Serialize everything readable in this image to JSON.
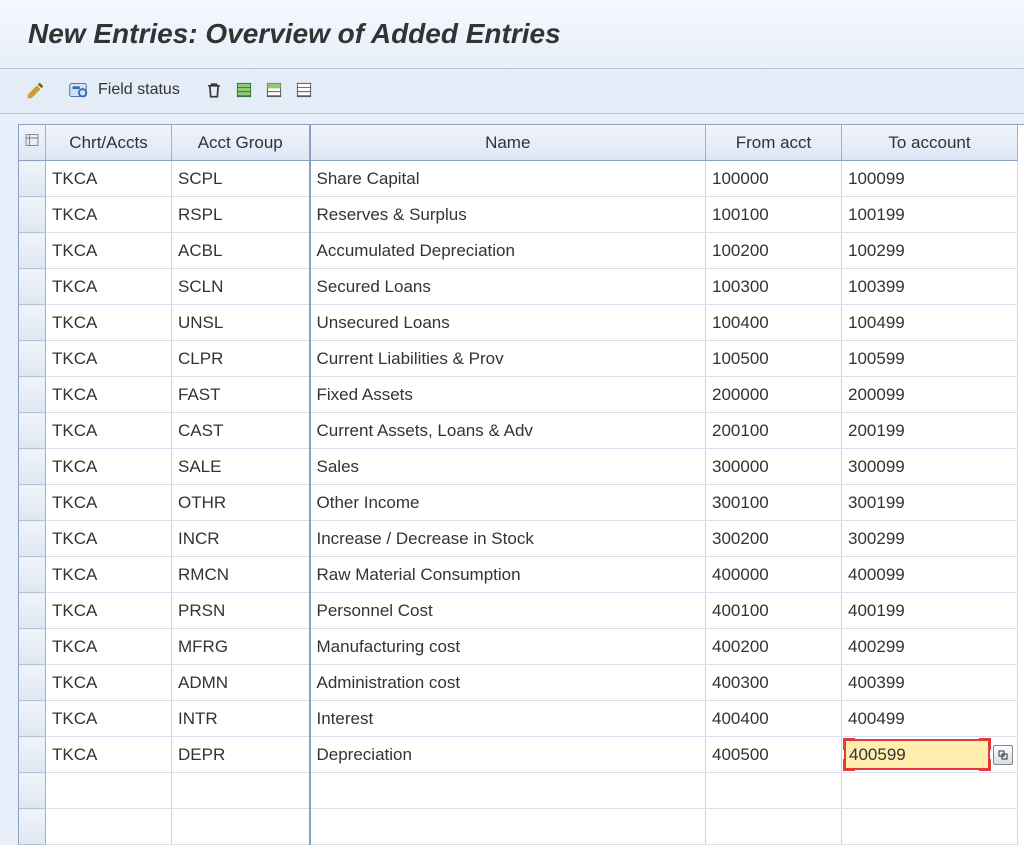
{
  "title": "New Entries: Overview of Added Entries",
  "toolbar": {
    "field_status_label": "Field status"
  },
  "table": {
    "headers": {
      "chrt": "Chrt/Accts",
      "grp": "Acct Group",
      "name": "Name",
      "from": "From acct",
      "to": "To account"
    },
    "rows": [
      {
        "chrt": "TKCA",
        "grp": "SCPL",
        "name": "Share Capital",
        "from": "100000",
        "to": "100099"
      },
      {
        "chrt": "TKCA",
        "grp": "RSPL",
        "name": "Reserves & Surplus",
        "from": "100100",
        "to": "100199"
      },
      {
        "chrt": "TKCA",
        "grp": "ACBL",
        "name": "Accumulated Depreciation",
        "from": "100200",
        "to": "100299"
      },
      {
        "chrt": "TKCA",
        "grp": "SCLN",
        "name": "Secured Loans",
        "from": "100300",
        "to": "100399"
      },
      {
        "chrt": "TKCA",
        "grp": "UNSL",
        "name": "Unsecured Loans",
        "from": "100400",
        "to": "100499"
      },
      {
        "chrt": "TKCA",
        "grp": "CLPR",
        "name": "Current Liabilities & Prov",
        "from": "100500",
        "to": "100599"
      },
      {
        "chrt": "TKCA",
        "grp": "FAST",
        "name": "Fixed Assets",
        "from": "200000",
        "to": "200099"
      },
      {
        "chrt": "TKCA",
        "grp": "CAST",
        "name": "Current Assets, Loans & Adv",
        "from": "200100",
        "to": "200199"
      },
      {
        "chrt": "TKCA",
        "grp": "SALE",
        "name": "Sales",
        "from": "300000",
        "to": "300099"
      },
      {
        "chrt": "TKCA",
        "grp": "OTHR",
        "name": "Other Income",
        "from": "300100",
        "to": "300199"
      },
      {
        "chrt": "TKCA",
        "grp": "INCR",
        "name": "Increase / Decrease in Stock",
        "from": "300200",
        "to": "300299"
      },
      {
        "chrt": "TKCA",
        "grp": "RMCN",
        "name": "Raw Material Consumption",
        "from": "400000",
        "to": "400099"
      },
      {
        "chrt": "TKCA",
        "grp": "PRSN",
        "name": "Personnel Cost",
        "from": "400100",
        "to": "400199"
      },
      {
        "chrt": "TKCA",
        "grp": "MFRG",
        "name": "Manufacturing cost",
        "from": "400200",
        "to": "400299"
      },
      {
        "chrt": "TKCA",
        "grp": "ADMN",
        "name": "Administration cost",
        "from": "400300",
        "to": "400399"
      },
      {
        "chrt": "TKCA",
        "grp": "INTR",
        "name": "Interest",
        "from": "400400",
        "to": "400499"
      },
      {
        "chrt": "TKCA",
        "grp": "DEPR",
        "name": "Depreciation",
        "from": "400500",
        "to": "400599"
      }
    ],
    "empty_rows": 2,
    "active_cell": {
      "row": 16,
      "col": "to"
    }
  }
}
